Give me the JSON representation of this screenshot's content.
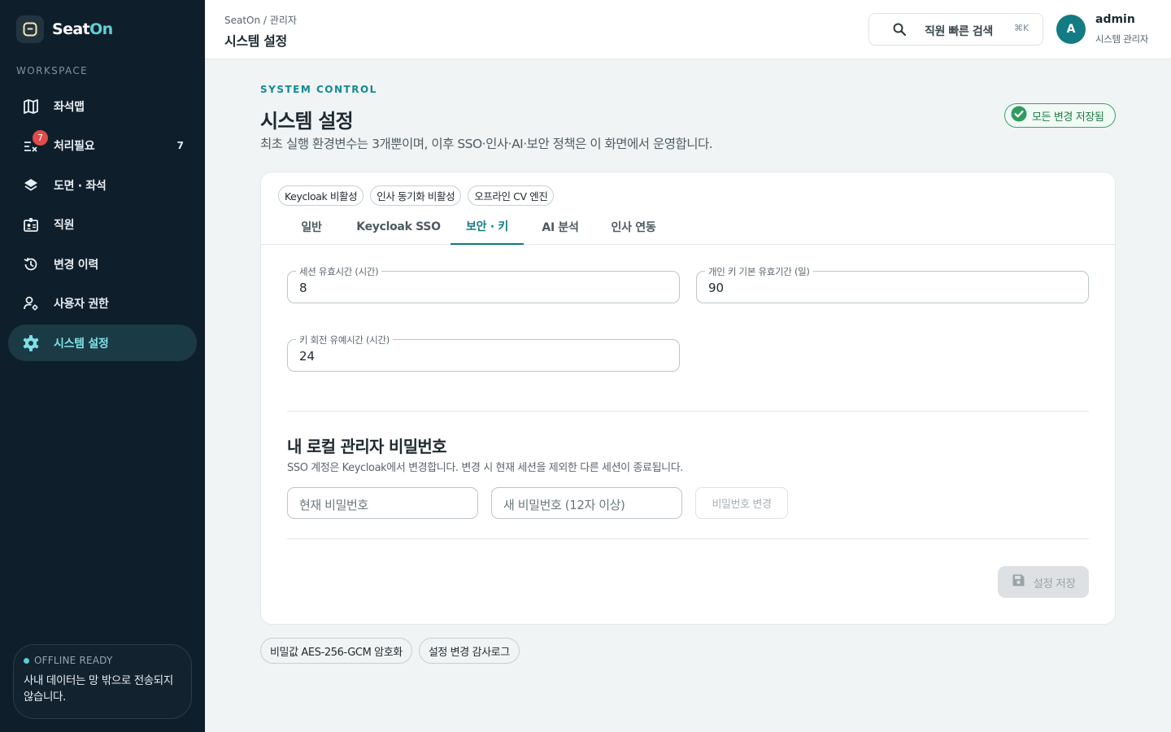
{
  "app": {
    "name_prefix": "Seat",
    "name_suffix": "On"
  },
  "sidebar": {
    "section_label": "WORKSPACE",
    "items": [
      {
        "label": "좌석맵",
        "icon": "map-icon"
      },
      {
        "label": "처리필요",
        "icon": "task-checklist-icon",
        "badge": "7",
        "count": "7"
      },
      {
        "label": "도면 · 좌석",
        "icon": "layers-icon"
      },
      {
        "label": "직원",
        "icon": "employee-badge-icon"
      },
      {
        "label": "변경 이력",
        "icon": "history-icon"
      },
      {
        "label": "사용자 권한",
        "icon": "user-settings-icon"
      },
      {
        "label": "시스템 설정",
        "icon": "gear-icon",
        "active": true
      }
    ],
    "offline": {
      "title": "OFFLINE READY",
      "text": "사내 데이터는 망 밖으로 전송되지 않습니다."
    }
  },
  "topbar": {
    "breadcrumb": "SeatOn / 관리자",
    "page_title": "시스템 설정",
    "search_label": "직원 빠른 검색",
    "search_shortcut": "⌘K",
    "user": {
      "initial": "A",
      "name": "admin",
      "role": "시스템 관리자"
    }
  },
  "page": {
    "eyebrow": "SYSTEM CONTROL",
    "title": "시스템 설정",
    "subtitle": "최초 실행 환경변수는 3개뿐이며, 이후 SSO·인사·AI·보안 정책은 이 화면에서 운영합니다.",
    "saved_status": "모든 변경 저장됨"
  },
  "card": {
    "status_chips": [
      "Keycloak 비활성",
      "인사 동기화 비활성",
      "오프라인 CV 엔진"
    ],
    "tabs": [
      "일반",
      "Keycloak SSO",
      "보안 · 키",
      "AI 분석",
      "인사 연동"
    ],
    "active_tab": "보안 · 키",
    "fields": {
      "session_ttl": {
        "label": "세션 유효시간 (시간)",
        "value": "8"
      },
      "key_ttl": {
        "label": "개인 키 기본 유효기간 (일)",
        "value": "90"
      },
      "rotation_grace": {
        "label": "키 회전 유예시간 (시간)",
        "value": "24"
      }
    },
    "password_section": {
      "title": "내 로컬 관리자 비밀번호",
      "description": "SSO 계정은 Keycloak에서 변경합니다. 변경 시 현재 세션을 제외한 다른 세션이 종료됩니다.",
      "current_placeholder": "현재 비밀번호",
      "new_placeholder": "새 비밀번호 (12자 이상)",
      "change_button": "비밀번호 변경"
    },
    "save_button": "설정 저장"
  },
  "footer_chips": [
    "비밀값 AES-256-GCM 암호화",
    "설정 변경 감사로그"
  ],
  "colors": {
    "accent": "#127b83",
    "sidebar_bg": "#0f1e2b",
    "badge": "#e04b4b",
    "success": "#3aa26a"
  }
}
